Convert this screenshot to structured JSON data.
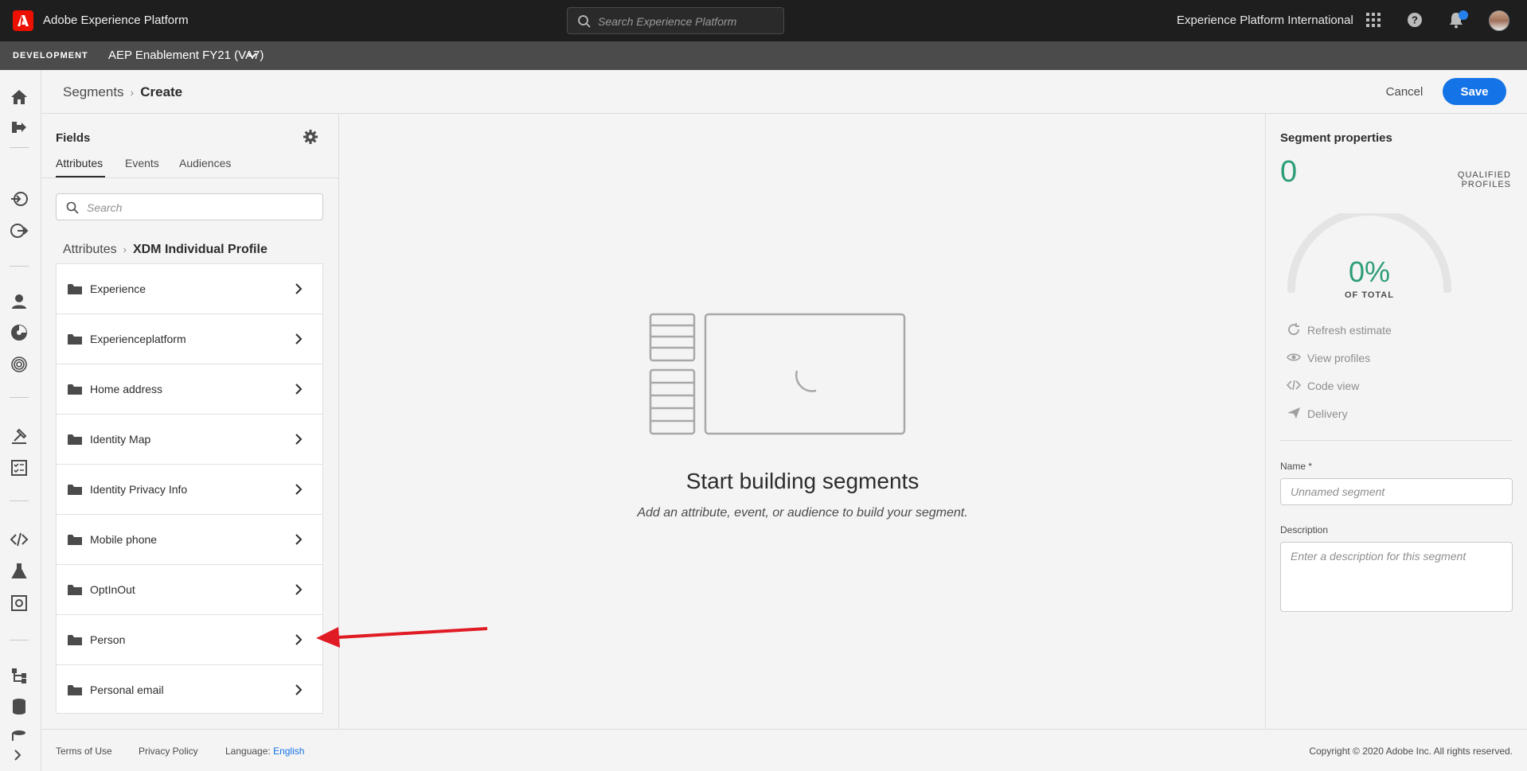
{
  "topbar": {
    "app_title": "Adobe Experience Platform",
    "search_placeholder": "Search Experience Platform",
    "org_name": "Experience Platform International"
  },
  "sandbox": {
    "environment": "DEVELOPMENT",
    "name": "AEP Enablement FY21 (VA7)"
  },
  "header": {
    "breadcrumb_parent": "Segments",
    "breadcrumb_current": "Create",
    "cancel_label": "Cancel",
    "save_label": "Save"
  },
  "fields": {
    "title": "Fields",
    "tabs": [
      {
        "label": "Attributes",
        "active": true
      },
      {
        "label": "Events",
        "active": false
      },
      {
        "label": "Audiences",
        "active": false
      }
    ],
    "search_placeholder": "Search",
    "breadcrumb_parent": "Attributes",
    "breadcrumb_current": "XDM Individual Profile",
    "items": [
      {
        "label": "Experience"
      },
      {
        "label": "Experienceplatform"
      },
      {
        "label": "Home address"
      },
      {
        "label": "Identity Map"
      },
      {
        "label": "Identity Privacy Info"
      },
      {
        "label": "Mobile phone"
      },
      {
        "label": "OptInOut"
      },
      {
        "label": "Person"
      },
      {
        "label": "Personal email"
      }
    ]
  },
  "canvas": {
    "title": "Start building segments",
    "subtitle": "Add an attribute, event, or audience to build your segment."
  },
  "properties": {
    "title": "Segment properties",
    "qualified_count": "0",
    "qualified_label": "QUALIFIED PROFILES",
    "percent": "0%",
    "percent_label": "OF TOTAL",
    "actions": [
      {
        "label": "Refresh estimate",
        "icon": "refresh-icon"
      },
      {
        "label": "View profiles",
        "icon": "eye-icon"
      },
      {
        "label": "Code view",
        "icon": "code-icon"
      },
      {
        "label": "Delivery",
        "icon": "send-icon"
      }
    ],
    "name_label": "Name *",
    "name_placeholder": "Unnamed segment",
    "description_label": "Description",
    "description_placeholder": "Enter a description for this segment"
  },
  "footer": {
    "terms": "Terms of Use",
    "privacy": "Privacy Policy",
    "language_label": "Language:",
    "language_value": "English",
    "copyright": "Copyright ©  2020 Adobe Inc.  All rights reserved."
  },
  "colors": {
    "accent": "#1473e6",
    "success": "#2d9d78",
    "annotation_arrow": "#e01b24",
    "brand": "#eb1000"
  }
}
